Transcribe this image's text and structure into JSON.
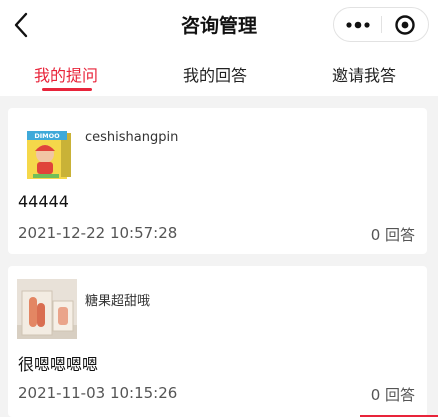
{
  "header": {
    "title": "咨询管理",
    "back_icon": "chevron-left-icon",
    "more_icon": "more-dots-icon",
    "close_icon": "target-circle-icon"
  },
  "tabs": [
    {
      "label": "我的提问",
      "active": true
    },
    {
      "label": "我的回答",
      "active": false
    },
    {
      "label": "邀请我答",
      "active": false
    }
  ],
  "accent_color": "#e8243a",
  "questions": [
    {
      "author": "ceshishangpin",
      "thumbnail": "toy-box-thumbnail",
      "thumbnail_text": "DIMOO",
      "question": "44444",
      "date": "2021-12-22 10:57:28",
      "answers": "0 回答"
    },
    {
      "author": "糖果超甜哦",
      "thumbnail": "wall-art-thumbnail",
      "question": "很嗯嗯嗯嗯",
      "date": "2021-11-03 10:15:26",
      "answers": "0 回答"
    }
  ]
}
